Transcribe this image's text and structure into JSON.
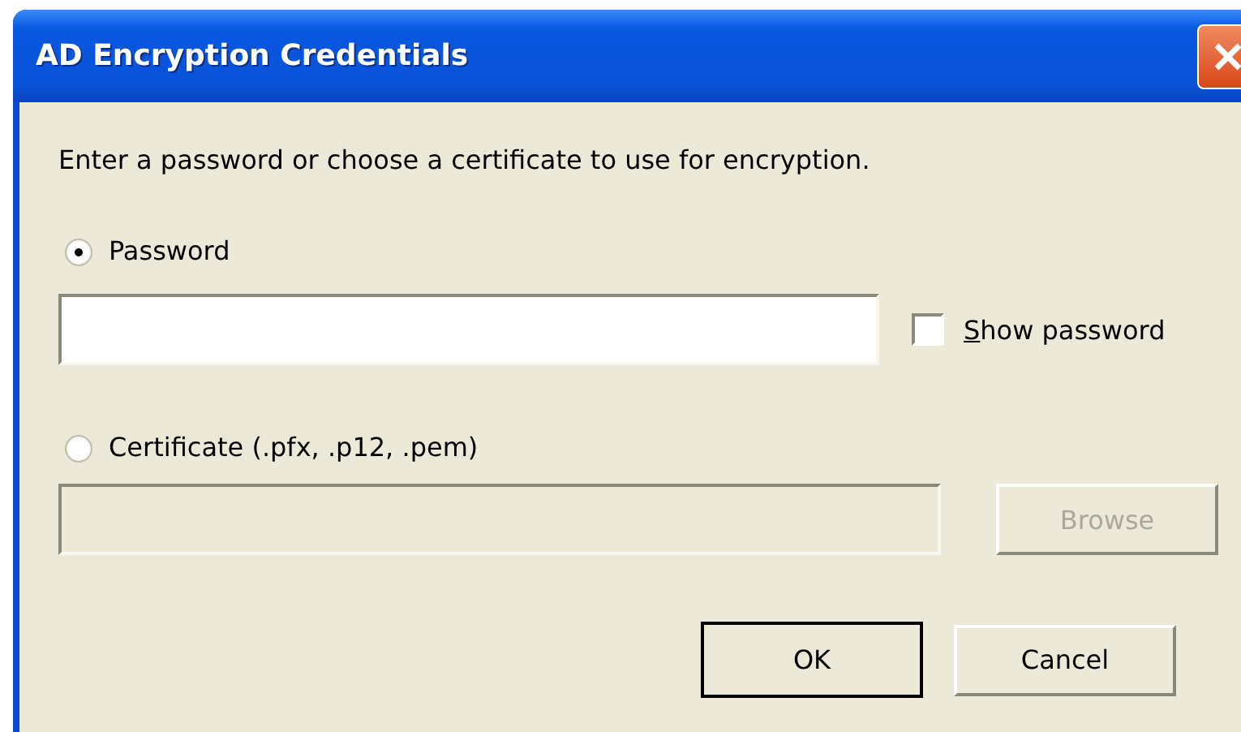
{
  "window": {
    "title": "AD Encryption Credentials"
  },
  "instructions": "Enter a password or choose a certificate to use for encryption.",
  "password": {
    "radio": {
      "label": "Password",
      "selected": true
    },
    "field": {
      "disabled": false
    },
    "show_password": {
      "label": "Show password",
      "checked": false
    }
  },
  "certificate": {
    "radio": {
      "label": "Certificate (.pfx, .p12, .pem)",
      "selected": false
    },
    "field": {
      "disabled": true
    },
    "browse": {
      "label": "Browse",
      "disabled": true
    }
  },
  "buttons": [
    {
      "label": "OK",
      "default": true
    },
    {
      "label": "Cancel",
      "default": false
    }
  ]
}
